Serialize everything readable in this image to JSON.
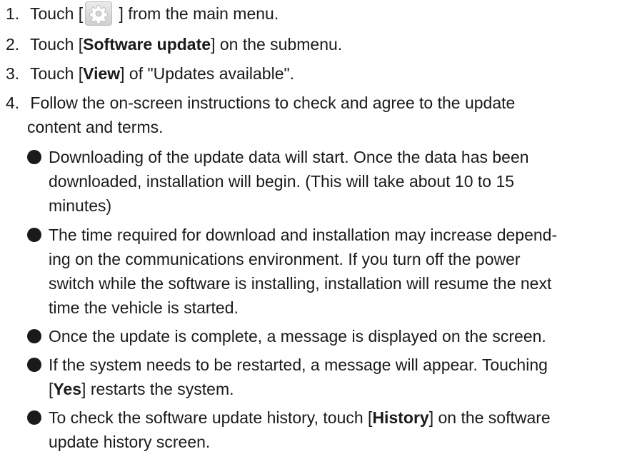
{
  "steps": [
    {
      "num": "1.",
      "before": "Touch [",
      "icon": "gear-icon",
      "after": " ] from the main menu."
    },
    {
      "num": "2.",
      "before": "Touch [",
      "bold": "Software update",
      "after": "] on the submenu."
    },
    {
      "num": "3.",
      "before": "Touch [",
      "bold": "View",
      "after": "] of \"Updates available\"."
    },
    {
      "num": "4.",
      "line1": "Follow the on-screen instructions to check and agree to the update",
      "line2": "content and terms."
    }
  ],
  "bullets": [
    {
      "lines": [
        "Downloading of the update data will start. Once the data has been",
        "downloaded, installation will begin. (This will take about 10 to 15",
        "minutes)"
      ]
    },
    {
      "lines": [
        "The time required for download and installation may increase depend-",
        "ing on the communications environment. If you turn off the power",
        "switch while the software is installing, installation will resume the next",
        "time the vehicle is started."
      ]
    },
    {
      "lines": [
        "Once the update is complete, a message is displayed on the screen."
      ]
    },
    {
      "line1_before": "If the system needs to be restarted, a message will appear. Touching",
      "line2_open": "[",
      "line2_bold": "Yes",
      "line2_after": "] restarts the system."
    },
    {
      "line1_before": "To check the software update history, touch [",
      "line1_bold": "History",
      "line1_after": "] on the software",
      "line2": "update history screen."
    }
  ]
}
